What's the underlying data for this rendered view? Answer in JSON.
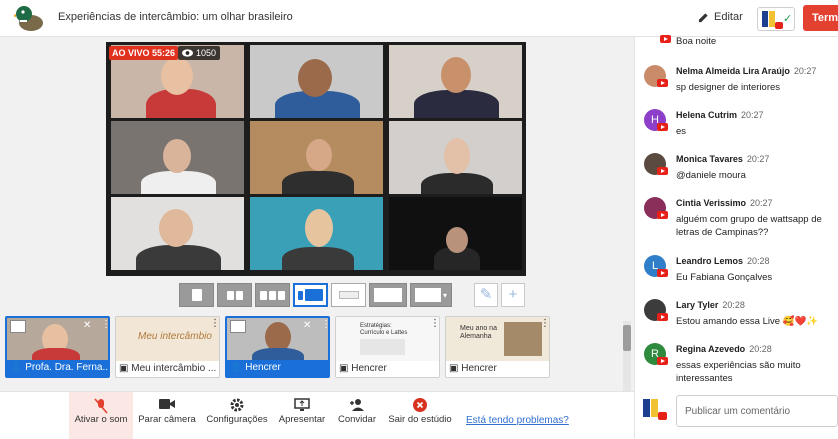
{
  "header": {
    "title": "Experiências de intercâmbio: um olhar brasileiro",
    "edit_label": "Editar",
    "end_label": "Termi",
    "check_mark": "✓"
  },
  "stage": {
    "live_label": "AO VIVO 55:26",
    "viewer_count": "1050"
  },
  "layouts": {
    "selected_index": 3,
    "count": 7
  },
  "tray": {
    "items": [
      {
        "label": "Profa. Dra. Ferna...",
        "kind": "camera",
        "selected": true
      },
      {
        "label": "Meu intercâmbio ...",
        "kind": "screen",
        "selected": false
      },
      {
        "label": "Hencrer",
        "kind": "camera",
        "selected": true
      },
      {
        "label": "Hencrer",
        "kind": "screen",
        "selected": false
      },
      {
        "label": "Hencrer",
        "kind": "screen",
        "selected": false
      }
    ],
    "slide1_text": "Meu intercâmbio",
    "slide2_title": "Estratégias: Currículo e Lattes",
    "slide3_title": "Meu ano na Alemanha"
  },
  "controls": {
    "mute": "Ativar o som",
    "camera": "Parar câmera",
    "settings": "Configurações",
    "present": "Apresentar",
    "invite": "Convidar",
    "leave": "Sair do estúdio",
    "help": "Está tendo problemas?"
  },
  "chat": {
    "placeholder": "Publicar um comentário",
    "partial_text": "Boa noite",
    "messages": [
      {
        "name": "Nelma Almeida Lira Araújo",
        "time": "20:27",
        "text": "sp designer de interiores",
        "avatar": "photo",
        "color": "#c98b6a"
      },
      {
        "name": "Helena Cutrim",
        "time": "20:27",
        "text": "es",
        "avatar": "H",
        "color": "#8e3fc9"
      },
      {
        "name": "Monica Tavares",
        "time": "20:27",
        "text": "@daniele moura",
        "avatar": "photo",
        "color": "#5a4a40"
      },
      {
        "name": "Cintia Verissimo",
        "time": "20:27",
        "text": "alguém com grupo de wattsapp de letras de Campinas??",
        "avatar": "photo",
        "color": "#8a2e5a"
      },
      {
        "name": "Leandro Lemos",
        "time": "20:28",
        "text": "Eu Fabiana Gonçalves",
        "avatar": "L",
        "color": "#2e7ec9"
      },
      {
        "name": "Lary Tyler",
        "time": "20:28",
        "text": "Estou amando essa Live 🥰❤️✨",
        "avatar": "photo",
        "color": "#3c3c3c"
      },
      {
        "name": "Regina Azevedo",
        "time": "20:28",
        "text": "essas experiências são muito interessantes",
        "avatar": "R",
        "color": "#2e8a3c"
      }
    ]
  }
}
